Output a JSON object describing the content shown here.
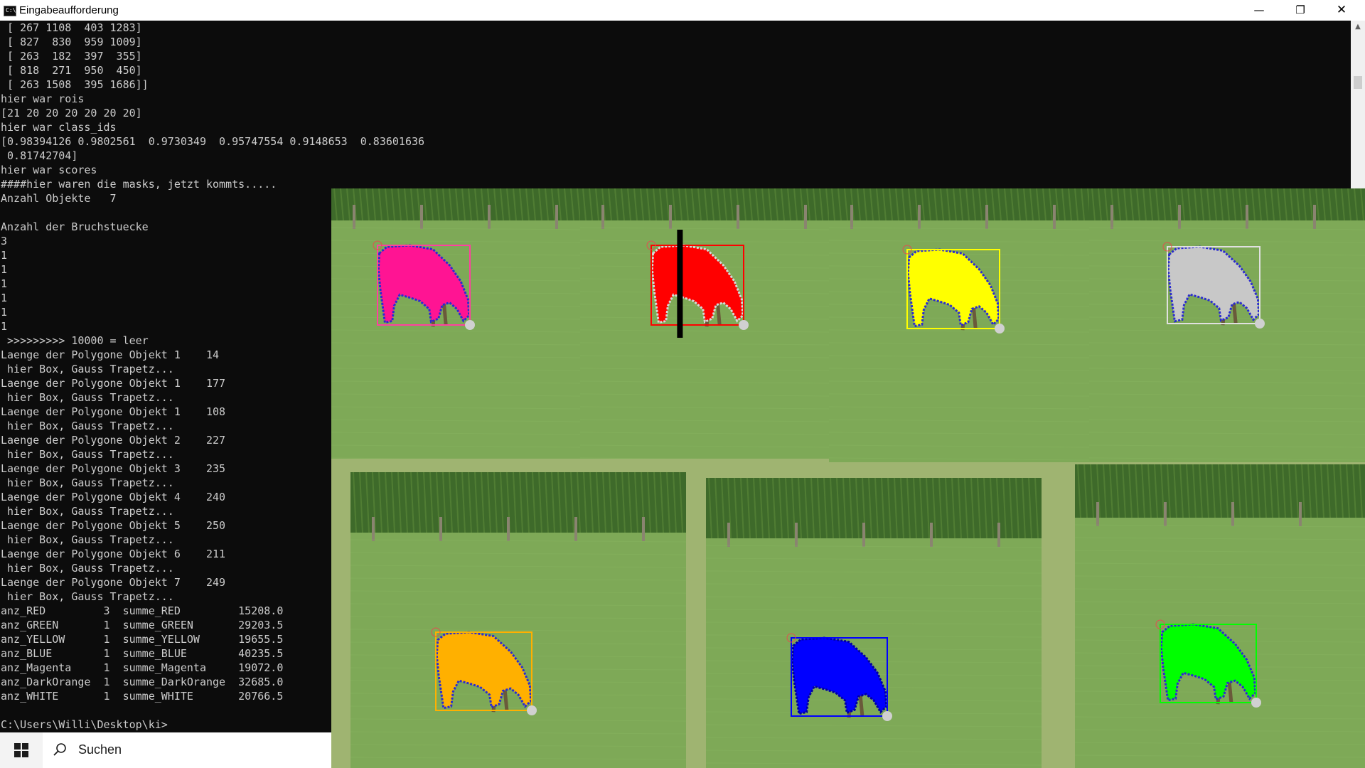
{
  "window": {
    "title": "Eingabeaufforderung",
    "icon": "cmd-icon",
    "icon_glyph": "C:\\",
    "controls": {
      "minimize": "—",
      "maximize": "❐",
      "close": "✕"
    }
  },
  "console": {
    "lines": [
      " [ 267 1108  403 1283]",
      " [ 827  830  959 1009]",
      " [ 263  182  397  355]",
      " [ 818  271  950  450]",
      " [ 263 1508  395 1686]]",
      "hier war rois",
      "[21 20 20 20 20 20 20]",
      "hier war class_ids",
      "[0.98394126 0.9802561  0.9730349  0.95747554 0.9148653  0.83601636",
      " 0.81742704]",
      "hier war scores",
      "####hier waren die masks, jetzt kommts.....",
      "Anzahl Objekte   7",
      "",
      "Anzahl der Bruchstuecke",
      "3",
      "1",
      "1",
      "1",
      "1",
      "1",
      "1",
      " >>>>>>>>> 10000 = leer",
      "Laenge der Polygone Objekt 1    14",
      " hier Box, Gauss Trapetz...",
      "Laenge der Polygone Objekt 1    177",
      " hier Box, Gauss Trapetz...",
      "Laenge der Polygone Objekt 1    108",
      " hier Box, Gauss Trapetz...",
      "Laenge der Polygone Objekt 2    227",
      " hier Box, Gauss Trapetz...",
      "Laenge der Polygone Objekt 3    235",
      " hier Box, Gauss Trapetz...",
      "Laenge der Polygone Objekt 4    240",
      " hier Box, Gauss Trapetz...",
      "Laenge der Polygone Objekt 5    250",
      " hier Box, Gauss Trapetz...",
      "Laenge der Polygone Objekt 6    211",
      " hier Box, Gauss Trapetz...",
      "Laenge der Polygone Objekt 7    249",
      " hier Box, Gauss Trapetz...",
      "anz_RED         3  summe_RED         15208.0",
      "anz_GREEN       1  summe_GREEN       29203.5",
      "anz_YELLOW      1  summe_YELLOW      19655.5",
      "anz_BLUE        1  summe_BLUE        40235.5",
      "anz_Magenta     1  summe_Magenta     19072.0",
      "anz_DarkOrange  1  summe_DarkOrange  32685.0",
      "anz_WHITE       1  summe_WHITE       20766.5",
      "",
      "C:\\Users\\Willi\\Desktop\\ki>"
    ]
  },
  "scrollbar": {
    "up_arrow": "▲"
  },
  "taskbar": {
    "start_icon": "windows-logo-icon",
    "search_icon": "search-icon",
    "search_label": "Suchen"
  },
  "colors": {
    "console_bg": "#0c0c0c",
    "console_text": "#cccccc",
    "grass": "#7ea957",
    "corn": "#3e6a2a",
    "magenta": "#ff1493",
    "red": "#ff0000",
    "yellow": "#ffff00",
    "white": "#c8c8c8",
    "darkorange": "#ffb000",
    "blue": "#0000ff",
    "green": "#00ff00"
  },
  "panels": [
    {
      "id": "magenta",
      "fill": "#ff1493",
      "box": "#ff3fa0",
      "outline": "#2b2bd0"
    },
    {
      "id": "red",
      "fill": "#ff0000",
      "box": "#ff0000",
      "outline": "#d8d8d8",
      "split": true
    },
    {
      "id": "yellow",
      "fill": "#ffff00",
      "box": "#ffff00",
      "outline": "#2b2bd0"
    },
    {
      "id": "white",
      "fill": "#c8c8c8",
      "box": "#e0e0e0",
      "outline": "#2b2bd0"
    },
    {
      "id": "darkorange",
      "fill": "#ffb000",
      "box": "#ffb000",
      "outline": "#2b2bd0"
    },
    {
      "id": "blue",
      "fill": "#0000ff",
      "box": "#0000ff",
      "outline": "#0000a0"
    },
    {
      "id": "green",
      "fill": "#00ff00",
      "box": "#00ff00",
      "outline": "#2b2bd0"
    }
  ]
}
